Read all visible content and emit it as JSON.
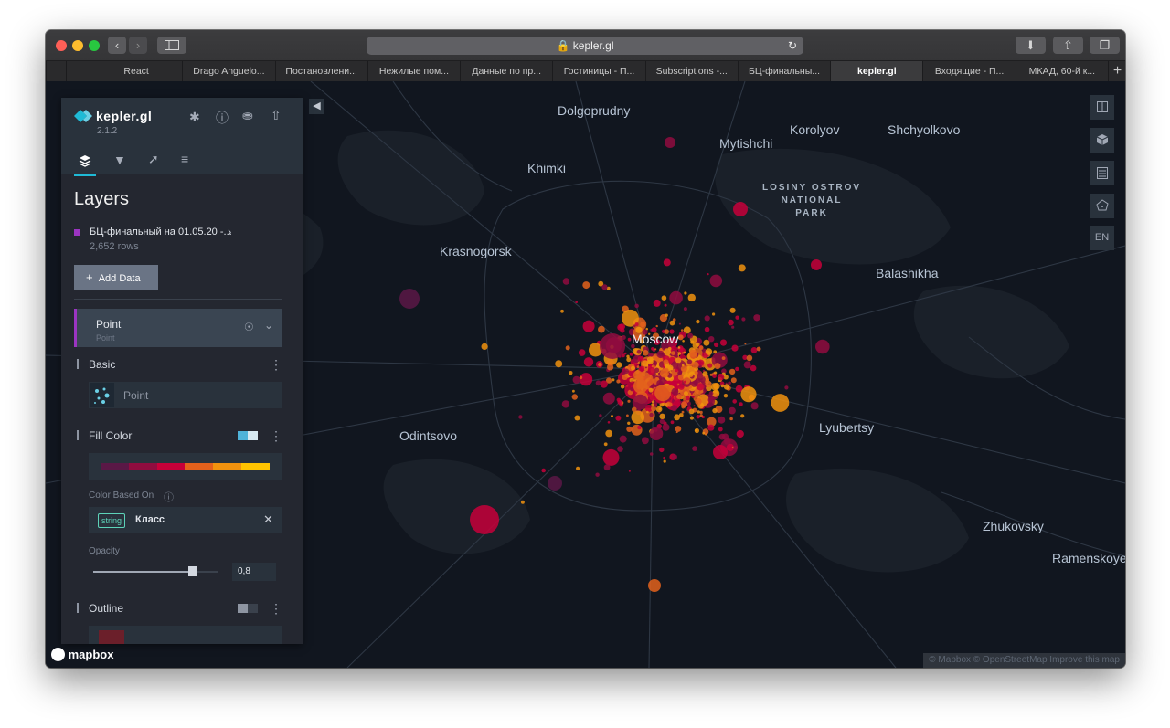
{
  "browser": {
    "url": "kepler.gl",
    "tabs": [
      "React",
      "Drago Anguelo...",
      "Постановлени...",
      "Нежилые пом...",
      "Данные по пр...",
      "Гостиницы - П...",
      "Subscriptions -...",
      "БЦ-финальны...",
      "kepler.gl",
      "Входящие - П...",
      "МКАД, 60-й к..."
    ],
    "active_tab": 8
  },
  "app": {
    "name": "kepler.gl",
    "version": "2.1.2",
    "panel_title": "Layers",
    "dataset": {
      "name": "БЦ-финальный на 01.05.20 -...",
      "rows": "2,652 rows",
      "color": "#9b34c1"
    },
    "add_data_label": "Add Data",
    "layer": {
      "name": "Point",
      "type": "Point"
    },
    "basic_label": "Basic",
    "basic_value": "Point",
    "fill_color_label": "Fill Color",
    "palette": [
      "#5a1846",
      "#900c3f",
      "#c70039",
      "#e3611c",
      "#f1920e",
      "#ffc300"
    ],
    "color_based_on_label": "Color Based On",
    "field_type": "string",
    "field_name": "Класс",
    "opacity_label": "Opacity",
    "opacity_value": "0,8",
    "opacity_level": 0.8,
    "outline_label": "Outline",
    "outline_color": "#6b1f2a"
  },
  "map": {
    "labels": {
      "dolgoprudny": "Dolgoprudny",
      "mytishchi": "Mytishchi",
      "korolyov": "Korolyov",
      "shchyolkovo": "Shchyolkovo",
      "khimki": "Khimki",
      "krasnogorsk": "Krasnogorsk",
      "balashikha": "Balashikha",
      "moscow": "Moscow",
      "odintsovo": "Odintsovo",
      "lyubertsy": "Lyubertsy",
      "zhukovsky": "Zhukovsky",
      "ramenskoye": "Ramenskoye"
    },
    "park": "LOSINY OSTROV\nNATIONAL\nPARK",
    "controls": [
      "EN"
    ],
    "attribution": "© Mapbox © OpenStreetMap  Improve this map",
    "logo": "mapbox"
  }
}
